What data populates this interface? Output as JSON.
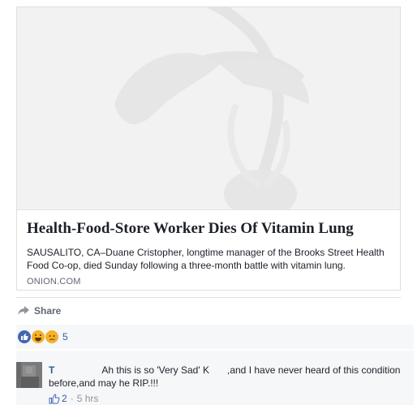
{
  "link_card": {
    "headline": "Health-Food-Store Worker Dies Of Vitamin Lung",
    "description": "SAUSALITO, CA–Duane Cristopher, longtime manager of the Brooks Street Health Food Co-op, died Sunday following a three-month battle with vitamin lung.",
    "domain": "ONION.COM",
    "thumbnail_icon": "onion-logo"
  },
  "actions": {
    "share_label": "Share",
    "share_icon": "share-arrow-icon"
  },
  "reactions": {
    "types": [
      "like",
      "haha",
      "sad"
    ],
    "count": "5",
    "colors": {
      "like": "#4267b2",
      "emoji": "#f7b125"
    }
  },
  "comment": {
    "author": "T",
    "text_part1": "Ah this is so 'Very Sad' K",
    "text_part2": ",and I have never heard of this condition before,and may he RIP.!!!",
    "likes": "2",
    "separator": "·",
    "time": "5 hrs"
  }
}
